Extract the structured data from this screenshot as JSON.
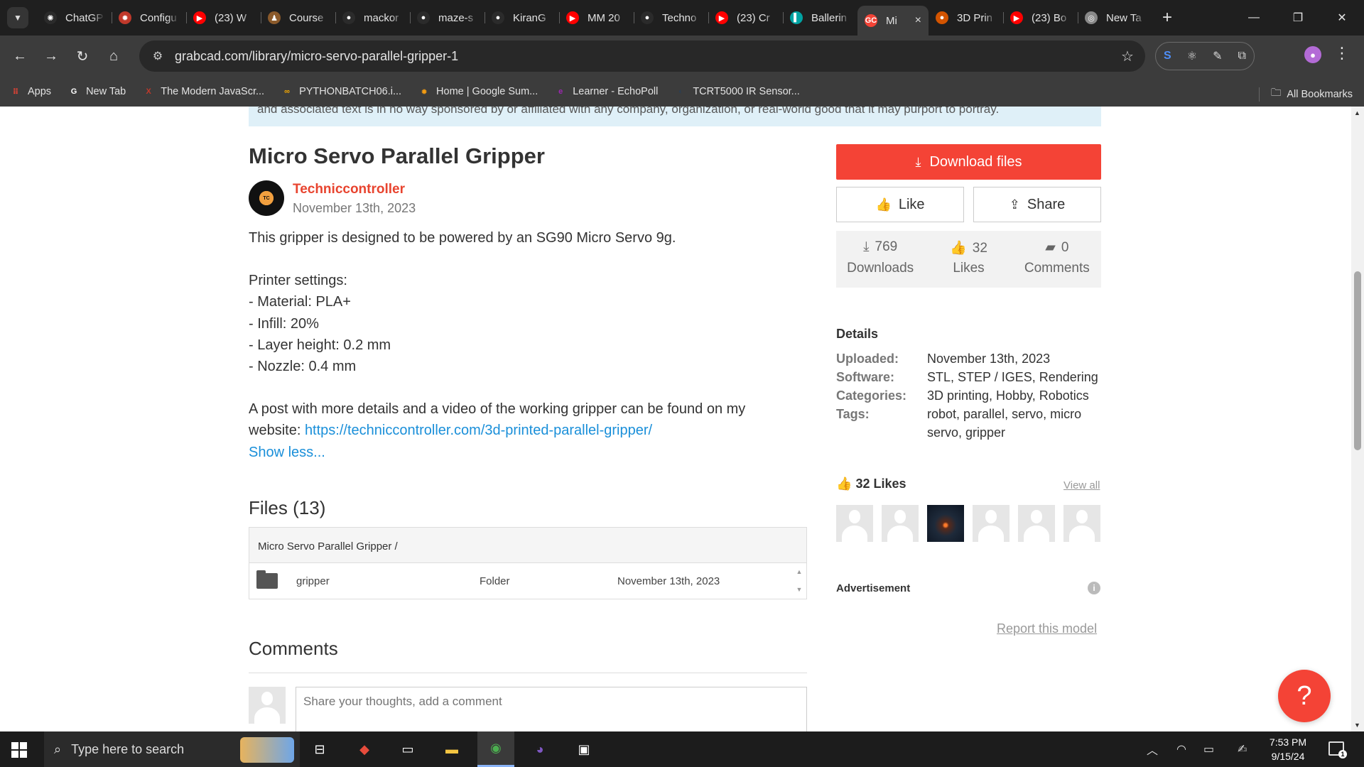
{
  "browser": {
    "tabs": [
      {
        "title": "ChatGP",
        "icon": "chatgpt-icon",
        "color": "#2b2b2b",
        "glyph": "✺"
      },
      {
        "title": "Configu",
        "icon": "config-sun-icon",
        "color": "#c0392b",
        "glyph": "✹"
      },
      {
        "title": "(23) W",
        "icon": "youtube-icon",
        "color": "#ff0000",
        "glyph": "▶"
      },
      {
        "title": "Course",
        "icon": "course-icon",
        "color": "#8b5a2b",
        "glyph": "♟"
      },
      {
        "title": "mackor",
        "icon": "github-icon",
        "color": "#2b2b2b",
        "glyph": "●"
      },
      {
        "title": "maze-s",
        "icon": "github-icon",
        "color": "#2b2b2b",
        "glyph": "●"
      },
      {
        "title": "KiranG",
        "icon": "github-icon",
        "color": "#2b2b2b",
        "glyph": "●"
      },
      {
        "title": "MM 20",
        "icon": "youtube-icon",
        "color": "#ff0000",
        "glyph": "▶"
      },
      {
        "title": "Techno",
        "icon": "github-icon",
        "color": "#2b2b2b",
        "glyph": "●"
      },
      {
        "title": "(23) Cr",
        "icon": "youtube-icon",
        "color": "#ff0000",
        "glyph": "▶"
      },
      {
        "title": "Ballerin",
        "icon": "ballerina-icon",
        "color": "#00a3a3",
        "glyph": "▌"
      },
      {
        "title": "Mi",
        "icon": "grabcad-icon",
        "color": "#f44336",
        "glyph": "GC",
        "active": true
      },
      {
        "title": "3D Prin",
        "icon": "printer-icon",
        "color": "#d35400",
        "glyph": "●"
      },
      {
        "title": "(23) Bo",
        "icon": "youtube-icon",
        "color": "#ff0000",
        "glyph": "▶"
      },
      {
        "title": "New Ta",
        "icon": "chrome-icon",
        "color": "#888888",
        "glyph": "◎"
      }
    ],
    "tab_close": "×",
    "new_tab": "+",
    "url": "grabcad.com/library/micro-servo-parallel-gripper-1",
    "bookmarks": [
      {
        "label": "Apps",
        "icon": "apps-grid-icon",
        "color": "#ea4335",
        "glyph": "⠿"
      },
      {
        "label": "New Tab",
        "icon": "google-icon",
        "color": "#ffffff",
        "glyph": "G"
      },
      {
        "label": "The Modern JavaScr...",
        "icon": "javascript-icon",
        "color": "#c0392b",
        "glyph": "X"
      },
      {
        "label": "PYTHONBATCH06.i...",
        "icon": "colab-icon",
        "color": "#f9ab00",
        "glyph": "∞"
      },
      {
        "label": "Home | Google Sum...",
        "icon": "summit-icon",
        "color": "#f39c12",
        "glyph": "✹"
      },
      {
        "label": "Learner - EchoPoll",
        "icon": "echopoll-icon",
        "color": "#9b27b0",
        "glyph": "e"
      },
      {
        "label": "TCRT5000 IR Sensor...",
        "icon": "sensor-icon",
        "color": "#2c3e50",
        "glyph": "◐"
      }
    ],
    "all_bookmarks": "All Bookmarks"
  },
  "page": {
    "notice": "and associated text is in no way sponsored by or affiliated with any company, organization, or real-world good that it may purport to portray.",
    "title": "Micro Servo Parallel Gripper",
    "author": "Techniccontroller",
    "date": "November 13th, 2023",
    "description": [
      "This gripper is designed to be powered by an SG90 Micro Servo 9g.",
      "",
      "Printer settings:",
      "- Material: PLA+",
      "- Infill: 20%",
      "- Layer height: 0.2 mm",
      "- Nozzle: 0.4 mm",
      "",
      "A post with more details and a video of the working gripper can be found on my"
    ],
    "website_prefix": "website: ",
    "website_link": "https://techniccontroller.com/3d-printed-parallel-gripper/",
    "show_less": "Show less...",
    "files_heading": "Files (13)",
    "files_path": "Micro Servo Parallel Gripper /",
    "files": [
      {
        "name": "gripper",
        "type": "Folder",
        "date": "November 13th, 2023"
      }
    ],
    "comments_heading": "Comments",
    "comment_placeholder": "Share your thoughts, add a comment",
    "download_label": "Download files",
    "like_label": "Like",
    "share_label": "Share",
    "stats": [
      {
        "value": "769",
        "label": "Downloads",
        "icon": "download-icon",
        "glyph": "⤓"
      },
      {
        "value": "32",
        "label": "Likes",
        "icon": "thumbs-up-icon",
        "glyph": "👍"
      },
      {
        "value": "0",
        "label": "Comments",
        "icon": "comment-icon",
        "glyph": "▰"
      }
    ],
    "details_heading": "Details",
    "details": [
      {
        "key": "Uploaded:",
        "value": "November 13th, 2023"
      },
      {
        "key": "Software:",
        "value": "STL, STEP / IGES, Rendering"
      },
      {
        "key": "Categories:",
        "value": "3D printing, Hobby, Robotics"
      },
      {
        "key": "Tags:",
        "value": "robot, parallel, servo, micro servo, gripper"
      }
    ],
    "likes_heading": "32 Likes",
    "view_all": "View all",
    "advertisement": "Advertisement",
    "report": "Report this model",
    "help": "?"
  },
  "taskbar": {
    "search_placeholder": "Type here to search",
    "time": "7:53 PM",
    "date": "9/15/24",
    "notification_count": "1"
  },
  "colors": {
    "brand_red": "#f44336",
    "link_blue": "#1a8fd9",
    "author_red": "#e8442f",
    "chrome_dark": "#1f1f1f",
    "chrome_toolbar": "#3c3c3c"
  }
}
